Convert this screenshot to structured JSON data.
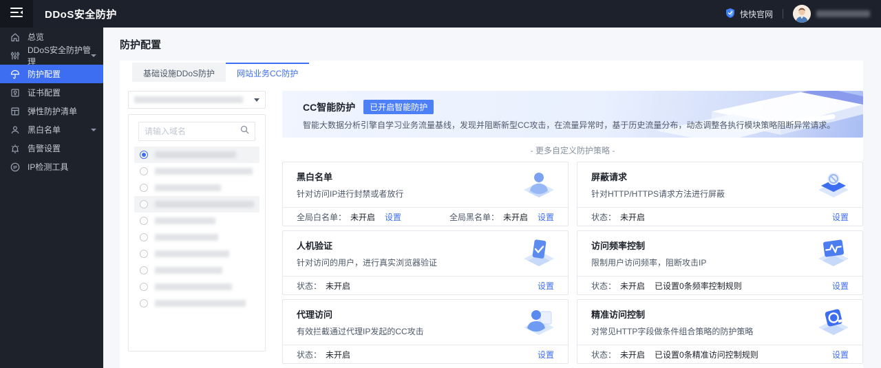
{
  "topbar": {
    "title": "DDoS安全防护",
    "site_link": "快快官网"
  },
  "sidebar": {
    "items": [
      {
        "icon": "home-icon",
        "label": "总览"
      },
      {
        "icon": "sliders-icon",
        "label": "DDoS安全防护管理",
        "caret": true
      },
      {
        "icon": "umbrella-icon",
        "label": "防护配置",
        "active": true
      },
      {
        "icon": "certificate-icon",
        "label": "证书配置"
      },
      {
        "icon": "list-icon",
        "label": "弹性防护清单"
      },
      {
        "icon": "user-icon",
        "label": "黑白名单",
        "caret": true
      },
      {
        "icon": "alarm-icon",
        "label": "告警设置"
      },
      {
        "icon": "ip-icon",
        "icon_text": "IP",
        "label": "IP检测工具"
      }
    ]
  },
  "page": {
    "title": "防护配置"
  },
  "tabs": {
    "infra": "基础设施DDoS防护",
    "cc": "网站业务CC防护"
  },
  "domain_panel": {
    "search_placeholder": "请输入域名",
    "selected_index": 0,
    "items_count": 10
  },
  "smart": {
    "title": "CC智能防护",
    "badge": "已开启智能防护",
    "desc": "智能大数据分析引擎自学习业务流量基线，发现并阻断新型CC攻击，在流量异常时，基于历史流量分布，动态调整各执行模块策略阻断异常请求。"
  },
  "more_divider": "- 更多自定义防护策略 -",
  "cards": {
    "blackwhite": {
      "title": "黑白名单",
      "desc": "针对访问IP进行封禁或者放行",
      "icon": "person-cube-icon",
      "whitelist_label": "全局白名单：",
      "whitelist_status": "未开启",
      "whitelist_action": "设置",
      "blacklist_label": "全局黑名单：",
      "blacklist_status": "未开启",
      "blacklist_action": "设置"
    },
    "block_request": {
      "title": "屏蔽请求",
      "desc": "针对HTTP/HTTPS请求方法进行屏蔽",
      "icon": "shield-block-cube-icon",
      "status_label": "状态：",
      "status": "未开启",
      "action": "设置"
    },
    "captcha": {
      "title": "人机验证",
      "desc": "针对访问的用户，进行真实浏览器验证",
      "icon": "verify-cube-icon",
      "status_label": "状态：",
      "status": "未开启",
      "action": "设置"
    },
    "rate_limit": {
      "title": "访问频率控制",
      "desc": "限制用户访问频率，阻断攻击IP",
      "icon": "pulse-cube-icon",
      "status_label": "状态：",
      "status": "未开启",
      "extra": "已设置0条频率控制规则",
      "action": "设置"
    },
    "proxy": {
      "title": "代理访问",
      "desc": "有效拦截通过代理IP发起的CC攻击",
      "icon": "proxy-cube-icon",
      "status_label": "状态：",
      "status": "未开启",
      "action": "设置"
    },
    "acl": {
      "title": "精准访问控制",
      "desc": "对常见HTTP字段做条件组合策略的防护策略",
      "icon": "target-cube-icon",
      "status_label": "状态：",
      "status": "未开启",
      "extra": "已设置0条精准访问控制规则",
      "action": "设置"
    }
  },
  "colors": {
    "accent": "#3d6ef2",
    "topbar_bg": "#1d212b",
    "sidebar_bg": "#1e222b",
    "badge_bg": "#4d7ff7"
  }
}
